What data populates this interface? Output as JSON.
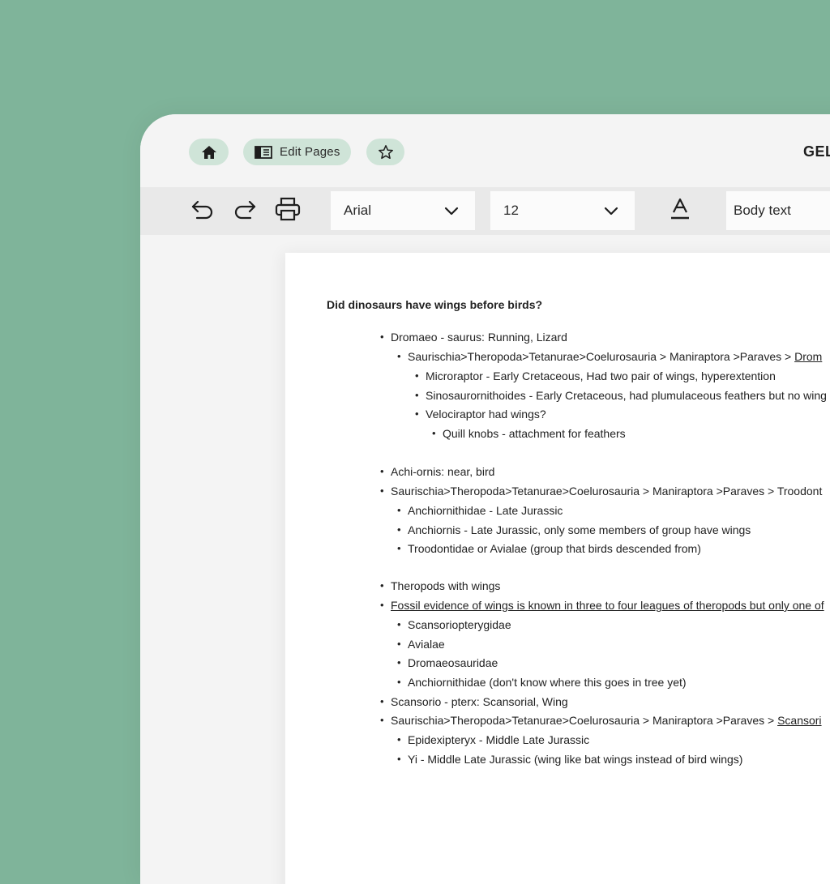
{
  "topbar": {
    "home_icon": "home-icon",
    "edit_icon": "book-open-icon",
    "edit_label": "Edit Pages",
    "star_icon": "star-icon",
    "brand": "GEL"
  },
  "toolbar": {
    "font": "Arial",
    "size": "12",
    "style": "Body text"
  },
  "doc": {
    "title": "Did dinosaurs have wings before birds?",
    "lines": [
      "Dromaeo - saurus: Running, Lizard",
      "Saurischia>Theropoda>Tetanurae>Coelurosauria > Maniraptora >Paraves > ",
      "Drom",
      "Microraptor - Early Cretaceous, Had two pair of wings, hyperextention",
      "Sinosaurornithoides - Early Cretaceous, had plumulaceous feathers but no wing",
      "Velociraptor had wings?",
      "Quill knobs - attachment for feathers",
      "Achi-ornis: near, bird",
      "Saurischia>Theropoda>Tetanurae>Coelurosauria > Maniraptora >Paraves > Troodont",
      "Anchiornithidae - Late Jurassic",
      "Anchiornis - Late Jurassic, only some members of group have wings",
      "Troodontidae or Avialae (group that birds descended from)",
      "Theropods with wings",
      "Fossil evidence of wings is known in three to four leagues of theropods but only one of",
      "Scansoriopterygidae",
      "Avialae",
      "Dromaeosauridae",
      "Anchiornithidae (don't know where this goes in tree yet)",
      "Scansorio - pterx: Scansorial, Wing",
      "Saurischia>Theropoda>Tetanurae>Coelurosauria > Maniraptora >Paraves > ",
      "Scansori",
      "Epidexipteryx - Middle Late Jurassic",
      "Yi - Middle Late Jurassic (wing like bat wings instead of bird wings)"
    ]
  }
}
